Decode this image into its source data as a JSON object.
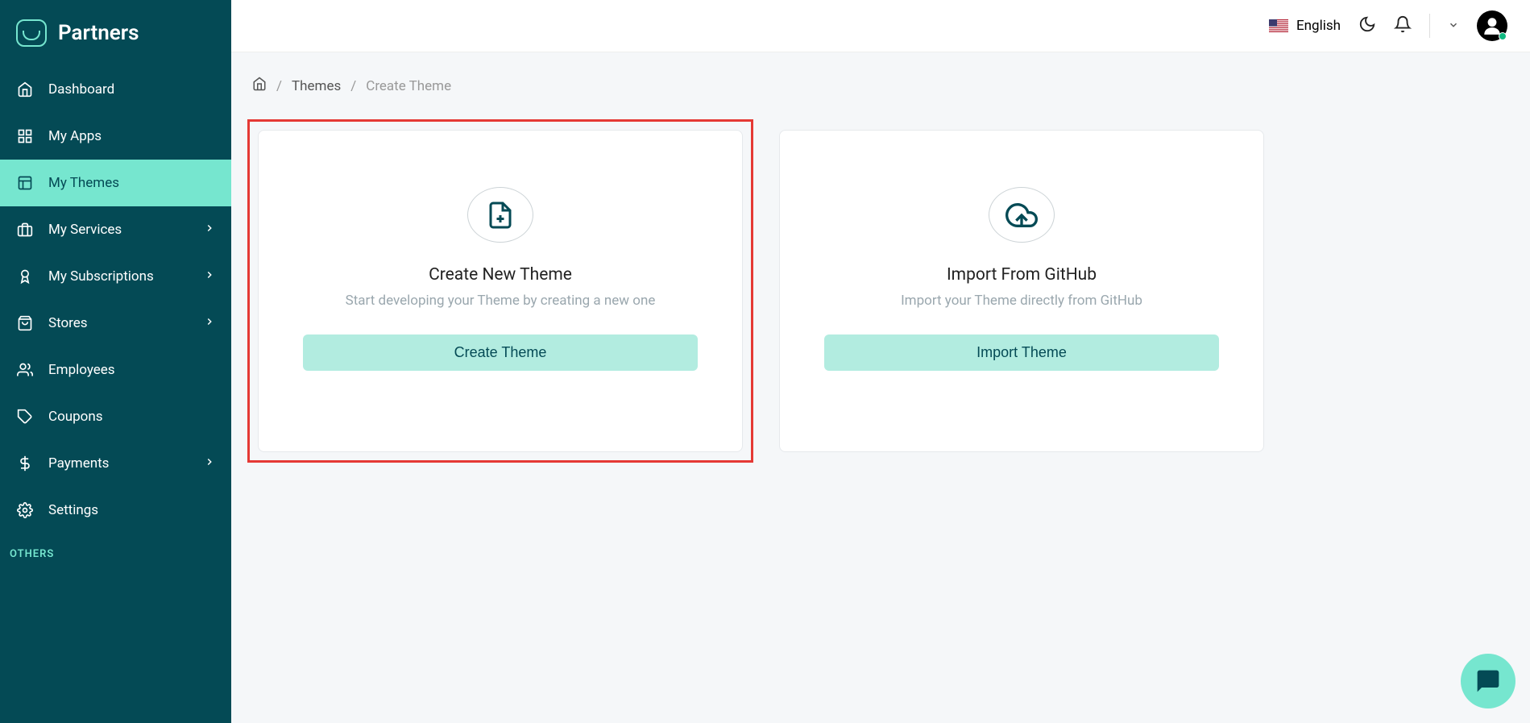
{
  "brand": {
    "name": "Partners"
  },
  "sidebar": {
    "items": [
      {
        "label": "Dashboard",
        "icon": "home",
        "chevron": false,
        "active": false
      },
      {
        "label": "My Apps",
        "icon": "grid",
        "chevron": false,
        "active": false
      },
      {
        "label": "My Themes",
        "icon": "layout",
        "chevron": false,
        "active": true
      },
      {
        "label": "My Services",
        "icon": "briefcase",
        "chevron": true,
        "active": false
      },
      {
        "label": "My Subscriptions",
        "icon": "ribbon",
        "chevron": true,
        "active": false
      },
      {
        "label": "Stores",
        "icon": "bag",
        "chevron": true,
        "active": false
      },
      {
        "label": "Employees",
        "icon": "users",
        "chevron": false,
        "active": false
      },
      {
        "label": "Coupons",
        "icon": "tag",
        "chevron": false,
        "active": false
      },
      {
        "label": "Payments",
        "icon": "dollar",
        "chevron": true,
        "active": false
      },
      {
        "label": "Settings",
        "icon": "gear",
        "chevron": false,
        "active": false
      }
    ],
    "section_others": "OTHERS"
  },
  "topbar": {
    "language": "English"
  },
  "breadcrumb": {
    "items": [
      {
        "label": "Themes",
        "current": false
      },
      {
        "label": "Create Theme",
        "current": true
      }
    ]
  },
  "cards": {
    "create": {
      "title": "Create New Theme",
      "subtitle": "Start developing your Theme by creating a new one",
      "button": "Create Theme"
    },
    "import": {
      "title": "Import From GitHub",
      "subtitle": "Import your Theme directly from GitHub",
      "button": "Import Theme"
    }
  }
}
